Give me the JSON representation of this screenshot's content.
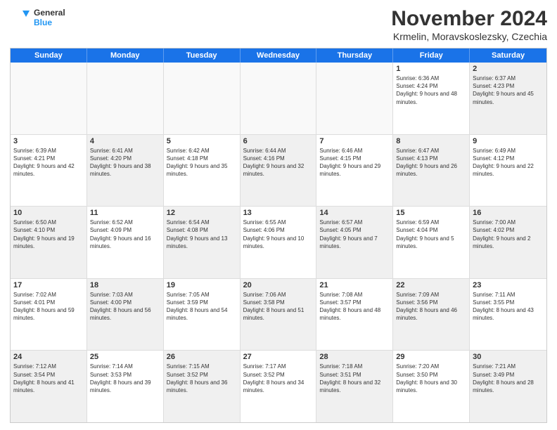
{
  "logo": {
    "line1": "General",
    "line2": "Blue"
  },
  "title": "November 2024",
  "location": "Krmelin, Moravskoslezsky, Czechia",
  "days_header": [
    "Sunday",
    "Monday",
    "Tuesday",
    "Wednesday",
    "Thursday",
    "Friday",
    "Saturday"
  ],
  "rows": [
    [
      {
        "day": "",
        "empty": true
      },
      {
        "day": "",
        "empty": true
      },
      {
        "day": "",
        "empty": true
      },
      {
        "day": "",
        "empty": true
      },
      {
        "day": "",
        "empty": true
      },
      {
        "day": "1",
        "info": "Sunrise: 6:36 AM\nSunset: 4:24 PM\nDaylight: 9 hours and 48 minutes."
      },
      {
        "day": "2",
        "info": "Sunrise: 6:37 AM\nSunset: 4:23 PM\nDaylight: 9 hours and 45 minutes.",
        "shaded": true
      }
    ],
    [
      {
        "day": "3",
        "info": "Sunrise: 6:39 AM\nSunset: 4:21 PM\nDaylight: 9 hours and 42 minutes."
      },
      {
        "day": "4",
        "info": "Sunrise: 6:41 AM\nSunset: 4:20 PM\nDaylight: 9 hours and 38 minutes.",
        "shaded": true
      },
      {
        "day": "5",
        "info": "Sunrise: 6:42 AM\nSunset: 4:18 PM\nDaylight: 9 hours and 35 minutes."
      },
      {
        "day": "6",
        "info": "Sunrise: 6:44 AM\nSunset: 4:16 PM\nDaylight: 9 hours and 32 minutes.",
        "shaded": true
      },
      {
        "day": "7",
        "info": "Sunrise: 6:46 AM\nSunset: 4:15 PM\nDaylight: 9 hours and 29 minutes."
      },
      {
        "day": "8",
        "info": "Sunrise: 6:47 AM\nSunset: 4:13 PM\nDaylight: 9 hours and 26 minutes.",
        "shaded": true
      },
      {
        "day": "9",
        "info": "Sunrise: 6:49 AM\nSunset: 4:12 PM\nDaylight: 9 hours and 22 minutes."
      }
    ],
    [
      {
        "day": "10",
        "info": "Sunrise: 6:50 AM\nSunset: 4:10 PM\nDaylight: 9 hours and 19 minutes.",
        "shaded": true
      },
      {
        "day": "11",
        "info": "Sunrise: 6:52 AM\nSunset: 4:09 PM\nDaylight: 9 hours and 16 minutes."
      },
      {
        "day": "12",
        "info": "Sunrise: 6:54 AM\nSunset: 4:08 PM\nDaylight: 9 hours and 13 minutes.",
        "shaded": true
      },
      {
        "day": "13",
        "info": "Sunrise: 6:55 AM\nSunset: 4:06 PM\nDaylight: 9 hours and 10 minutes."
      },
      {
        "day": "14",
        "info": "Sunrise: 6:57 AM\nSunset: 4:05 PM\nDaylight: 9 hours and 7 minutes.",
        "shaded": true
      },
      {
        "day": "15",
        "info": "Sunrise: 6:59 AM\nSunset: 4:04 PM\nDaylight: 9 hours and 5 minutes."
      },
      {
        "day": "16",
        "info": "Sunrise: 7:00 AM\nSunset: 4:02 PM\nDaylight: 9 hours and 2 minutes.",
        "shaded": true
      }
    ],
    [
      {
        "day": "17",
        "info": "Sunrise: 7:02 AM\nSunset: 4:01 PM\nDaylight: 8 hours and 59 minutes."
      },
      {
        "day": "18",
        "info": "Sunrise: 7:03 AM\nSunset: 4:00 PM\nDaylight: 8 hours and 56 minutes.",
        "shaded": true
      },
      {
        "day": "19",
        "info": "Sunrise: 7:05 AM\nSunset: 3:59 PM\nDaylight: 8 hours and 54 minutes."
      },
      {
        "day": "20",
        "info": "Sunrise: 7:06 AM\nSunset: 3:58 PM\nDaylight: 8 hours and 51 minutes.",
        "shaded": true
      },
      {
        "day": "21",
        "info": "Sunrise: 7:08 AM\nSunset: 3:57 PM\nDaylight: 8 hours and 48 minutes."
      },
      {
        "day": "22",
        "info": "Sunrise: 7:09 AM\nSunset: 3:56 PM\nDaylight: 8 hours and 46 minutes.",
        "shaded": true
      },
      {
        "day": "23",
        "info": "Sunrise: 7:11 AM\nSunset: 3:55 PM\nDaylight: 8 hours and 43 minutes."
      }
    ],
    [
      {
        "day": "24",
        "info": "Sunrise: 7:12 AM\nSunset: 3:54 PM\nDaylight: 8 hours and 41 minutes.",
        "shaded": true
      },
      {
        "day": "25",
        "info": "Sunrise: 7:14 AM\nSunset: 3:53 PM\nDaylight: 8 hours and 39 minutes."
      },
      {
        "day": "26",
        "info": "Sunrise: 7:15 AM\nSunset: 3:52 PM\nDaylight: 8 hours and 36 minutes.",
        "shaded": true
      },
      {
        "day": "27",
        "info": "Sunrise: 7:17 AM\nSunset: 3:52 PM\nDaylight: 8 hours and 34 minutes."
      },
      {
        "day": "28",
        "info": "Sunrise: 7:18 AM\nSunset: 3:51 PM\nDaylight: 8 hours and 32 minutes.",
        "shaded": true
      },
      {
        "day": "29",
        "info": "Sunrise: 7:20 AM\nSunset: 3:50 PM\nDaylight: 8 hours and 30 minutes."
      },
      {
        "day": "30",
        "info": "Sunrise: 7:21 AM\nSunset: 3:49 PM\nDaylight: 8 hours and 28 minutes.",
        "shaded": true
      }
    ]
  ]
}
